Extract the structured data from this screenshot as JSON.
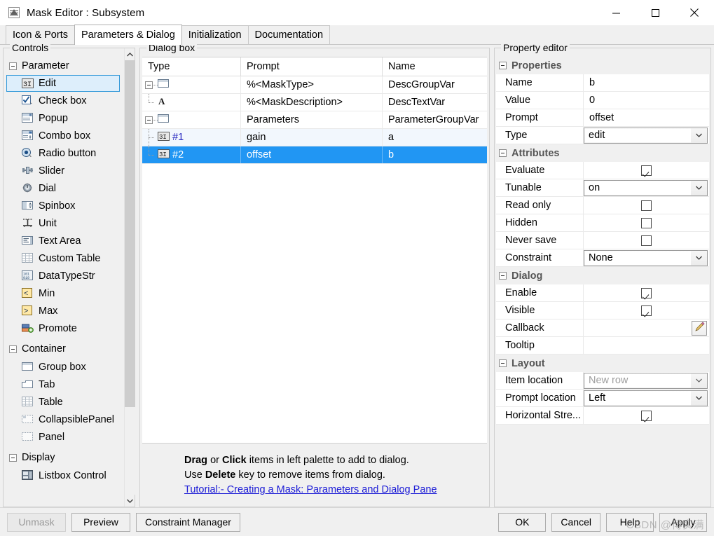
{
  "window": {
    "title": "Mask Editor : Subsystem",
    "icon": "simulink-mask-icon",
    "minimize_label": "–",
    "maximize_label": "□",
    "close_label": "✕"
  },
  "tabs": [
    {
      "label": "Icon & Ports",
      "active": false
    },
    {
      "label": "Parameters & Dialog",
      "active": true
    },
    {
      "label": "Initialization",
      "active": false
    },
    {
      "label": "Documentation",
      "active": false
    }
  ],
  "palette": {
    "title": "Controls",
    "groups": [
      {
        "label": "Parameter",
        "expanded": true,
        "items": [
          {
            "label": "Edit",
            "icon": "edit-param-icon",
            "selected": true
          },
          {
            "label": "Check box",
            "icon": "checkbox-param-icon",
            "selected": false
          },
          {
            "label": "Popup",
            "icon": "popup-param-icon",
            "selected": false
          },
          {
            "label": "Combo box",
            "icon": "combobox-param-icon",
            "selected": false
          },
          {
            "label": "Radio button",
            "icon": "radiobutton-param-icon",
            "selected": false
          },
          {
            "label": "Slider",
            "icon": "slider-param-icon",
            "selected": false
          },
          {
            "label": "Dial",
            "icon": "dial-param-icon",
            "selected": false
          },
          {
            "label": "Spinbox",
            "icon": "spinbox-param-icon",
            "selected": false
          },
          {
            "label": "Unit",
            "icon": "unit-param-icon",
            "selected": false
          },
          {
            "label": "Text Area",
            "icon": "textarea-param-icon",
            "selected": false
          },
          {
            "label": "Custom Table",
            "icon": "customtable-param-icon",
            "selected": false
          },
          {
            "label": "DataTypeStr",
            "icon": "datatypestr-param-icon",
            "selected": false
          },
          {
            "label": "Min",
            "icon": "min-param-icon",
            "selected": false
          },
          {
            "label": "Max",
            "icon": "max-param-icon",
            "selected": false
          },
          {
            "label": "Promote",
            "icon": "promote-param-icon",
            "selected": false
          }
        ]
      },
      {
        "label": "Container",
        "expanded": true,
        "items": [
          {
            "label": "Group box",
            "icon": "groupbox-icon",
            "selected": false
          },
          {
            "label": "Tab",
            "icon": "tab-icon",
            "selected": false
          },
          {
            "label": "Table",
            "icon": "table-icon",
            "selected": false
          },
          {
            "label": "CollapsiblePanel",
            "icon": "collapsiblepanel-icon",
            "selected": false
          },
          {
            "label": "Panel",
            "icon": "panel-icon",
            "selected": false
          }
        ]
      },
      {
        "label": "Display",
        "expanded": true,
        "items": [
          {
            "label": "Listbox Control",
            "icon": "listbox-control-icon",
            "selected": false
          }
        ]
      }
    ]
  },
  "dialog_box": {
    "title": "Dialog box",
    "columns": [
      "Type",
      "Prompt",
      "Name"
    ],
    "rows": [
      {
        "type_icon": "group-box-node-icon",
        "type_label": "",
        "prompt": "%<MaskType>",
        "name": "DescGroupVar",
        "depth": 0,
        "expandable": true,
        "state": "normal"
      },
      {
        "type_icon": "text-node-icon",
        "type_label": "",
        "prompt": "%<MaskDescription>",
        "name": "DescTextVar",
        "depth": 1,
        "expandable": false,
        "state": "normal"
      },
      {
        "type_icon": "group-box-node-icon",
        "type_label": "",
        "prompt": "Parameters",
        "name": "ParameterGroupVar",
        "depth": 0,
        "expandable": true,
        "state": "normal"
      },
      {
        "type_icon": "edit-node-icon",
        "type_label": "#1",
        "prompt": "gain",
        "name": "a",
        "depth": 1,
        "expandable": false,
        "state": "alt"
      },
      {
        "type_icon": "edit-node-icon",
        "type_label": "#2",
        "prompt": "offset",
        "name": "b",
        "depth": 1,
        "expandable": false,
        "state": "selected"
      }
    ],
    "hints": {
      "line1_parts": [
        "Drag",
        " or ",
        "Click",
        " items in left palette to add to dialog."
      ],
      "line2_parts": [
        "Use ",
        "Delete",
        " key to remove items from dialog."
      ],
      "link": "Tutorial:- Creating a Mask: Parameters and Dialog Pane"
    }
  },
  "property_editor": {
    "title": "Property editor",
    "sections": [
      {
        "label": "Properties",
        "expanded": true,
        "rows": [
          {
            "key": "Name",
            "kind": "text",
            "value": "b"
          },
          {
            "key": "Value",
            "kind": "text",
            "value": "0"
          },
          {
            "key": "Prompt",
            "kind": "text",
            "value": "offset"
          },
          {
            "key": "Type",
            "kind": "combo",
            "value": "edit",
            "enabled": true
          }
        ]
      },
      {
        "label": "Attributes",
        "expanded": true,
        "rows": [
          {
            "key": "Evaluate",
            "kind": "checkbox",
            "value": true
          },
          {
            "key": "Tunable",
            "kind": "combo",
            "value": "on",
            "enabled": true
          },
          {
            "key": "Read only",
            "kind": "checkbox",
            "value": false
          },
          {
            "key": "Hidden",
            "kind": "checkbox",
            "value": false
          },
          {
            "key": "Never save",
            "kind": "checkbox",
            "value": false
          },
          {
            "key": "Constraint",
            "kind": "combo",
            "value": "None",
            "enabled": true
          }
        ]
      },
      {
        "label": "Dialog",
        "expanded": true,
        "rows": [
          {
            "key": "Enable",
            "kind": "checkbox",
            "value": true
          },
          {
            "key": "Visible",
            "kind": "checkbox",
            "value": true
          },
          {
            "key": "Callback",
            "kind": "edit-button",
            "value": "",
            "icon": "pencil-icon"
          },
          {
            "key": "Tooltip",
            "kind": "text",
            "value": ""
          }
        ]
      },
      {
        "label": "Layout",
        "expanded": true,
        "rows": [
          {
            "key": "Item location",
            "kind": "combo",
            "value": "New row",
            "enabled": false
          },
          {
            "key": "Prompt location",
            "kind": "combo",
            "value": "Left",
            "enabled": true
          },
          {
            "key": "Horizontal Stre...",
            "kind": "checkbox",
            "value": true
          }
        ]
      }
    ]
  },
  "bottom_bar": {
    "left_buttons": [
      {
        "label": "Unmask",
        "disabled": true
      },
      {
        "label": "Preview",
        "disabled": false
      },
      {
        "label": "Constraint Manager",
        "disabled": false
      }
    ],
    "right_buttons": [
      {
        "label": "OK",
        "disabled": false
      },
      {
        "label": "Cancel",
        "disabled": false
      },
      {
        "label": "Help",
        "disabled": false
      },
      {
        "label": "Apply",
        "disabled": false
      }
    ]
  },
  "watermark": "CSDN @博实满",
  "colors": {
    "selection_blue": "#2196f3",
    "alt_row": "#f2f7fd",
    "palette_selected_bg": "#ddeefb",
    "palette_selected_border": "#3399d9",
    "link": "#1a1ad6",
    "node_number": "#2828c0",
    "window_bg": "#f0f0f0"
  }
}
